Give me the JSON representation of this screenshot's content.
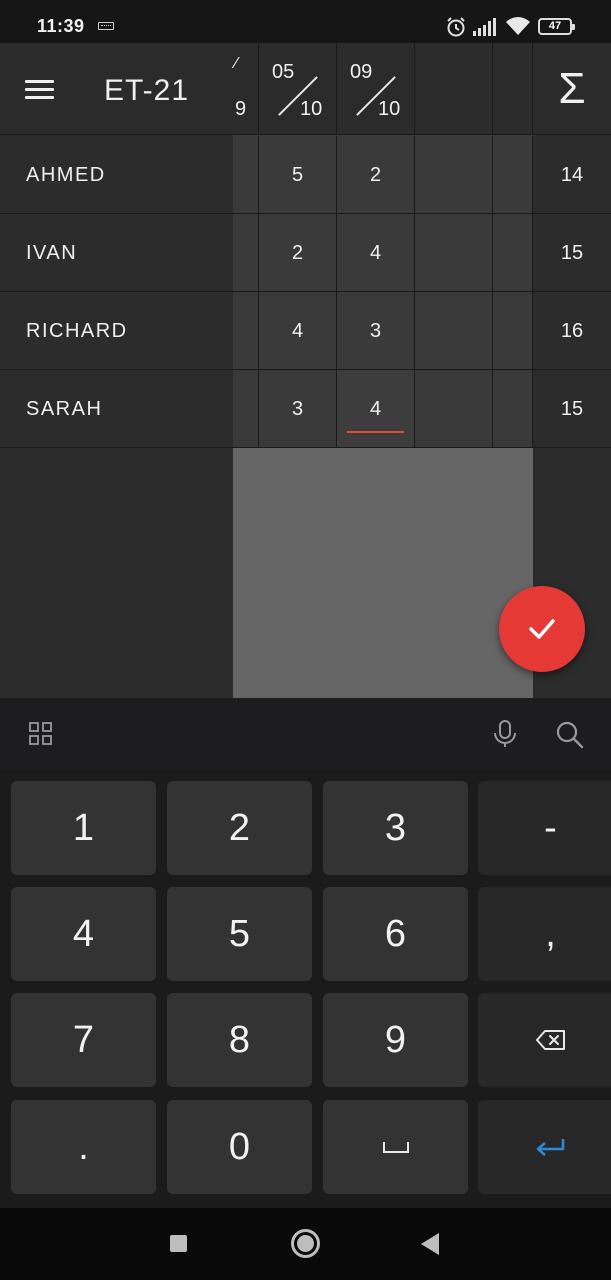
{
  "status_bar": {
    "time": "11:39",
    "battery": "47",
    "icons": [
      "keyboard-icon",
      "alarm-icon",
      "signal-icon",
      "wifi-icon",
      "battery-icon"
    ]
  },
  "header": {
    "menu_icon": "hamburger-icon",
    "title": "ET-21",
    "partial_column": {
      "top": "⁄",
      "bottom": "9"
    },
    "columns": [
      {
        "top": "05",
        "bottom": "10"
      },
      {
        "top": "09",
        "bottom": "10"
      },
      {
        "top": "",
        "bottom": ""
      },
      {
        "top": "",
        "bottom": ""
      }
    ],
    "sum_symbol": "Σ"
  },
  "students": [
    {
      "name": "AHMED",
      "grades": [
        "5",
        "2",
        "",
        ""
      ],
      "sum": "14"
    },
    {
      "name": "IVAN",
      "grades": [
        "2",
        "4",
        "",
        ""
      ],
      "sum": "15"
    },
    {
      "name": "RICHARD",
      "grades": [
        "4",
        "3",
        "",
        ""
      ],
      "sum": "16"
    },
    {
      "name": "SARAH",
      "grades": [
        "3",
        "4",
        "",
        ""
      ],
      "sum": "15"
    }
  ],
  "active_cell": {
    "student": "SARAH",
    "column": "09/10",
    "value": "4"
  },
  "fab": {
    "icon": "check-icon",
    "color": "#e53935"
  },
  "keyboard": {
    "toolbar_icons": [
      "grid-icon",
      "microphone-icon",
      "search-icon"
    ],
    "keys": [
      [
        "1",
        "2",
        "3",
        "-"
      ],
      [
        "4",
        "5",
        "6",
        ","
      ],
      [
        "7",
        "8",
        "9",
        "backspace-icon"
      ],
      [
        ".",
        "0",
        "␣",
        "enter-icon"
      ]
    ]
  },
  "nav_bar": {
    "icons": [
      "recents-icon",
      "home-icon",
      "back-icon"
    ]
  }
}
